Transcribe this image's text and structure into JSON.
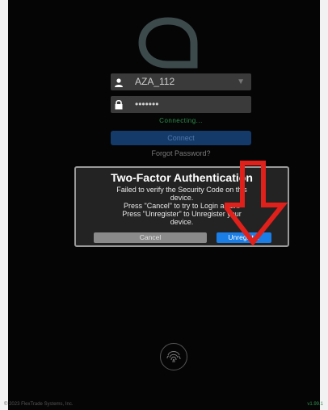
{
  "login": {
    "username_value": "AZA_112",
    "password_mask": "•••••••",
    "status_text": "Connecting...",
    "connect_label": "Connect",
    "forgot_label": "Forgot Password?"
  },
  "dialog": {
    "title": "Two-Factor Authentication",
    "message_lines": [
      "Failed to verify the Security Code on this",
      "device.",
      "Press \"Cancel\" to try to Login again.",
      "Press \"Unregister\" to Unregister your",
      "device."
    ],
    "cancel_label": "Cancel",
    "unregister_label": "Unregister"
  },
  "footer": {
    "copyright": "© 2023 FlexTrade Systems, Inc.",
    "version": "v1.99.1"
  },
  "icons": {
    "logo": "app-logo-icon",
    "user": "user-icon",
    "lock": "lock-icon",
    "dropdown": "chevron-down-icon",
    "fingerprint": "fingerprint-icon",
    "annotation": "red-down-arrow"
  },
  "colors": {
    "background": "#050505",
    "accent": "#1a7ee6",
    "status": "#2e8f4c",
    "annotation": "#e0201a"
  }
}
